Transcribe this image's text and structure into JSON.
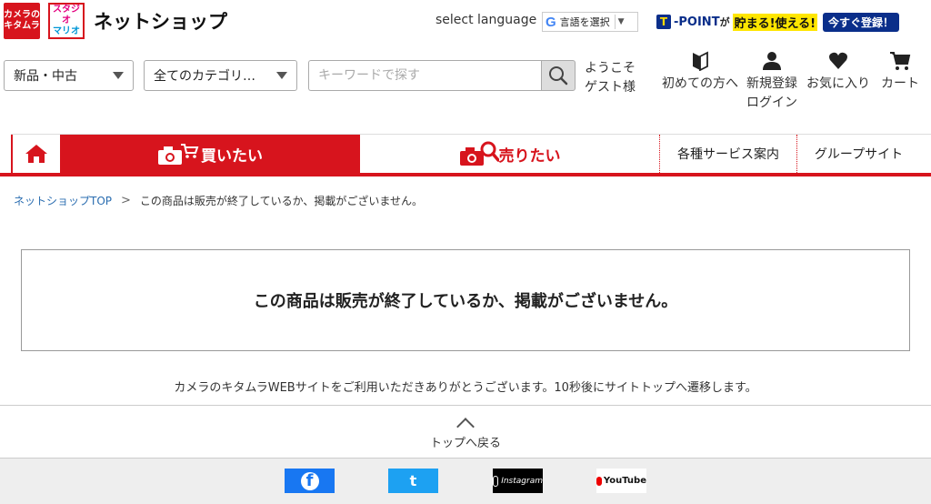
{
  "header": {
    "kitamura_logo": [
      "カメラの",
      "キタムラ"
    ],
    "studio_logo": [
      "スタジオ",
      "マリオ"
    ],
    "site_title": "ネットショップ",
    "lang_label": "select language",
    "translate_label": "言語を選択",
    "translate_arrow": "▼",
    "tpoint": {
      "logo": "T",
      "name": "-POINT",
      "connector": "が",
      "copy": "貯まる!使える!",
      "button": "今すぐ登録！"
    }
  },
  "search": {
    "condition": "新品・中古",
    "category": "全てのカテゴリ…",
    "keyword_placeholder": "キーワードで探す",
    "welcome_line1": "ようこそ",
    "welcome_line2": "ゲスト様"
  },
  "header_icons": {
    "beginner": "初めての方へ",
    "register": "新規登録",
    "login": "ログイン",
    "favorites": "お気に入り",
    "cart": "カート"
  },
  "nav": {
    "buy": "買いたい",
    "sell": "売りたい",
    "services": "各種サービス案内",
    "group": "グループサイト"
  },
  "breadcrumb": {
    "home": "ネットショップTOP",
    "separator": ">",
    "current": "この商品は販売が終了しているか、掲載がございません。"
  },
  "message": "この商品は販売が終了しているか、掲載がございません。",
  "notice": "カメラのキタムラWEBサイトをご利用いただきありがとうございます。10秒後にサイトトップへ遷移します。",
  "back_to_top": "トップへ戻る",
  "sns": {
    "facebook": "f",
    "twitter": "t",
    "instagram": "Instagram",
    "youtube": "YouTube"
  },
  "colors": {
    "brand_red": "#d7141d",
    "tpoint_blue": "#0a2e8a",
    "link_blue": "#2a6db0"
  }
}
